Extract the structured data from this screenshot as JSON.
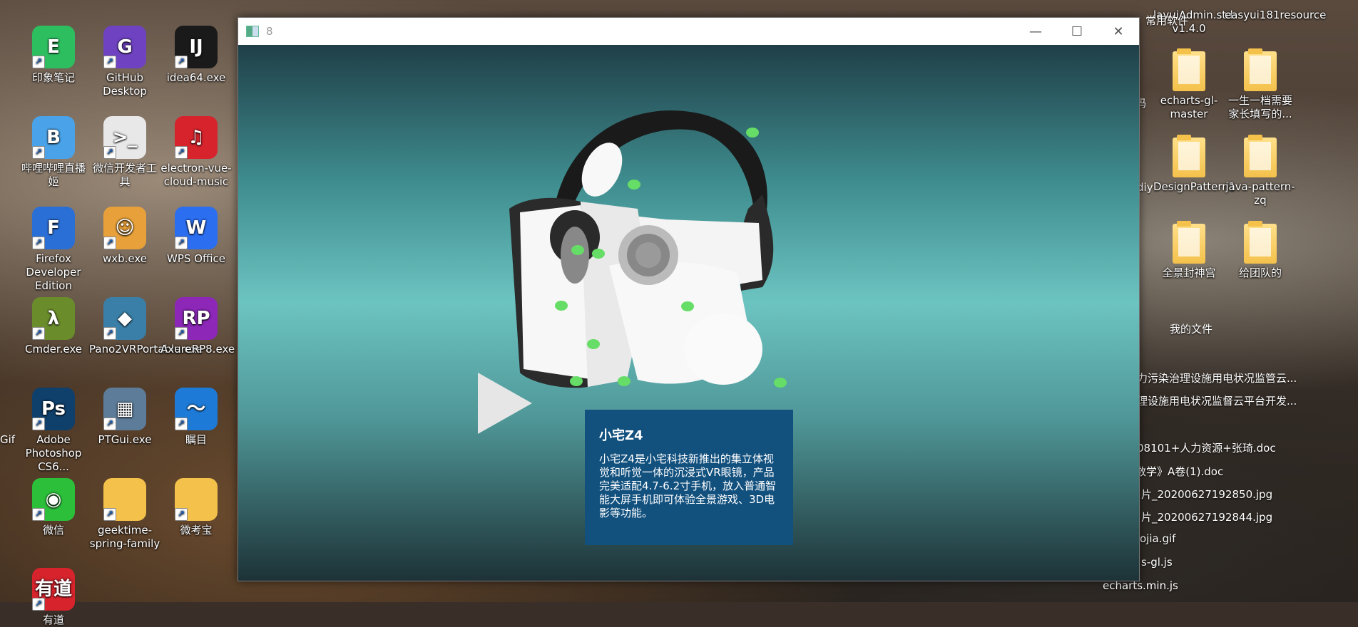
{
  "desktop": {
    "icons": [
      {
        "label": "印象笔记",
        "icon": "evernote-icon",
        "color": "#2dbe60",
        "glyph": "E"
      },
      {
        "label": "GitHub Desktop",
        "icon": "github-icon",
        "color": "#6f42c1",
        "glyph": "G"
      },
      {
        "label": "idea64.exe",
        "icon": "intellij-icon",
        "color": "#1a1a1a",
        "glyph": "IJ"
      },
      {
        "label": "哔哩哔哩直播姬",
        "icon": "bilibili-live-icon",
        "color": "#4aa3e8",
        "glyph": "B"
      },
      {
        "label": "微信开发者工具",
        "icon": "wechat-devtools-icon",
        "color": "#e8e8e8",
        "glyph": ">_"
      },
      {
        "label": "electron-vue-cloud-music",
        "icon": "netease-music-icon",
        "color": "#d6232c",
        "glyph": "♫"
      },
      {
        "label": "Firefox Developer Edition",
        "icon": "firefox-icon",
        "color": "#2a6fd6",
        "glyph": "F"
      },
      {
        "label": "wxb.exe",
        "icon": "monkey-icon",
        "color": "#e8a13a",
        "glyph": "☺"
      },
      {
        "label": "WPS Office",
        "icon": "wps-icon",
        "color": "#2b6ef0",
        "glyph": "W"
      },
      {
        "label": "Cmder.exe",
        "icon": "cmder-icon",
        "color": "#6a8c2b",
        "glyph": "λ"
      },
      {
        "label": "Pano2VRPortable.exe",
        "icon": "pano2vr-icon",
        "color": "#3a7fa8",
        "glyph": "◆"
      },
      {
        "label": "AxureRP8.exe",
        "icon": "axure-icon",
        "color": "#8c27b8",
        "glyph": "RP"
      },
      {
        "label": "Adobe Photoshop CS6...",
        "icon": "photoshop-icon",
        "color": "#0f3f6b",
        "glyph": "Ps"
      },
      {
        "label": "PTGui.exe",
        "icon": "ptgui-icon",
        "color": "#5d7c99",
        "glyph": "▦"
      },
      {
        "label": "瞩目",
        "icon": "zhumu-icon",
        "color": "#1d7ad6",
        "glyph": "〜"
      },
      {
        "label": "微信",
        "icon": "wechat-icon",
        "color": "#2cbf3a",
        "glyph": "◉"
      },
      {
        "label": "geektime-spring-family",
        "icon": "folder-icon",
        "color": "#f4c14b",
        "glyph": ""
      },
      {
        "label": "微考宝",
        "icon": "chrome-doc-icon",
        "color": "#f4c14b",
        "glyph": ""
      },
      {
        "label": "有道",
        "icon": "youdao-icon",
        "color": "#d6232c",
        "glyph": "有道"
      }
    ],
    "right_icons": [
      {
        "label": "layuiAdmin.std-v1.4.0"
      },
      {
        "label": "easyui181resource"
      },
      {
        "label": "echarts-gl-master"
      },
      {
        "label": "一生一档需要家长填写的..."
      },
      {
        "label": "DesignPattern1"
      },
      {
        "label": "java-pattern-zq"
      },
      {
        "label": "全景封神宫"
      },
      {
        "label": "给团队的"
      }
    ],
    "partial_labels": [
      "常用软件",
      "码",
      "diy",
      "我的文件"
    ],
    "left_edge_labels": [
      "Gif"
    ],
    "file_list": [
      "力污染治理设施用电状况监管云...",
      "理设施用电状况监督云平台开发...",
      "08101+人力资源+张琦.doc",
      "数学》A卷(1).doc",
      "片_20200627192850.jpg",
      "片_20200627192844.jpg",
      "ojia.gif",
      "s-gl.js",
      "echarts.min.js"
    ]
  },
  "window": {
    "title": "8",
    "minimize": "—",
    "maximize": "☐",
    "close": "✕"
  },
  "scene": {
    "product_title": "小宅Z4",
    "description": "小宅Z4是小宅科技新推出的集立体视觉和听觉一体的沉浸式VR眼镜，产品完美适配4.7-6.2寸手机，放入普通智能大屏手机即可体验全景游戏、3D电影等功能。",
    "hotspot_color": "#66dd66",
    "panel_color": "#12507e"
  }
}
